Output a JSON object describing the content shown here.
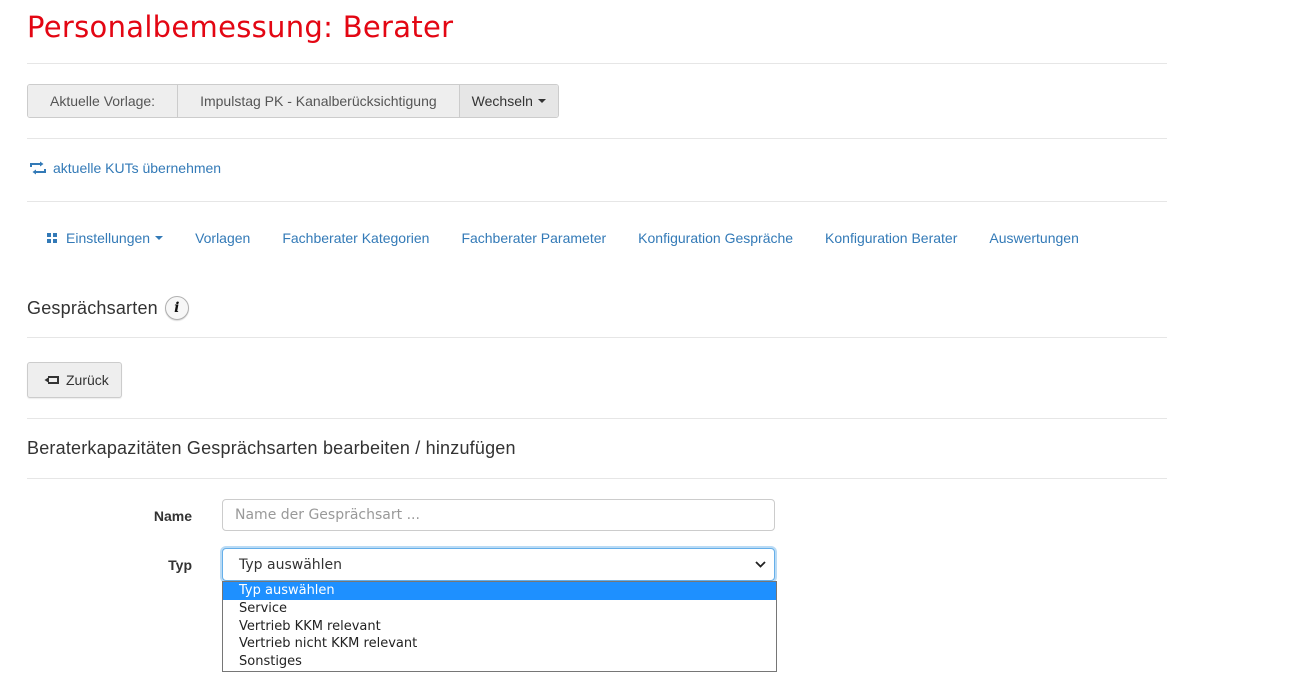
{
  "page": {
    "title": "Personalbemessung: Berater"
  },
  "template_bar": {
    "label": "Aktuelle Vorlage:",
    "value": "Impulstag PK - Kanalberücksichtigung",
    "switch_label": "Wechseln"
  },
  "kut_link": {
    "label": "aktuelle KUTs übernehmen",
    "icon": "retweet-icon"
  },
  "nav": {
    "items": [
      {
        "label": "Einstellungen",
        "icon": "grid-icon",
        "dropdown": true
      },
      {
        "label": "Vorlagen"
      },
      {
        "label": "Fachberater Kategorien"
      },
      {
        "label": "Fachberater Parameter"
      },
      {
        "label": "Konfiguration Gespräche"
      },
      {
        "label": "Konfiguration Berater"
      },
      {
        "label": "Auswertungen"
      }
    ]
  },
  "section": {
    "title": "Gesprächsarten",
    "info_icon": "i"
  },
  "back_button": {
    "label": "Zurück",
    "icon": "back-arrow-icon"
  },
  "form": {
    "title": "Beraterkapazitäten Gesprächsarten bearbeiten / hinzufügen",
    "name_label": "Name",
    "name_placeholder": "Name der Gesprächsart ...",
    "type_label": "Typ",
    "type_selected": "Typ auswählen",
    "type_options": [
      "Typ auswählen",
      "Service",
      "Vertrieb KKM relevant",
      "Vertrieb nicht KKM relevant",
      "Sonstiges"
    ]
  },
  "colors": {
    "title_red": "#e30613",
    "link_blue": "#337ab7",
    "focus_blue": "#66afe9",
    "option_highlight": "#1e90ff"
  }
}
